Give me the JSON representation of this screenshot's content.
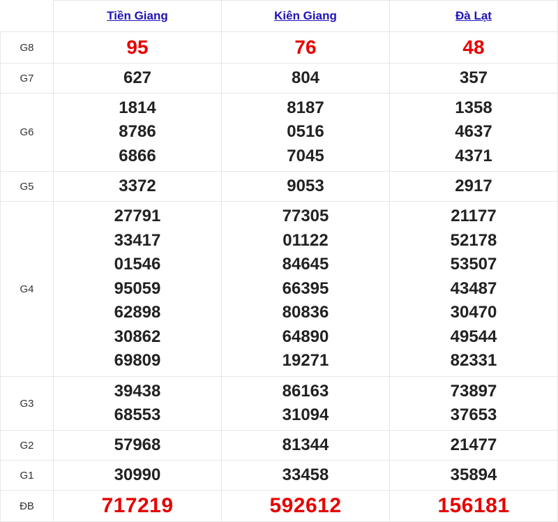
{
  "provinces": [
    "Tiền Giang",
    "Kiên Giang",
    "Đà Lạt"
  ],
  "colors": {
    "header_link": "#1f13b8",
    "highlight": "#e60000",
    "text": "#222222",
    "border": "#e6e6e6"
  },
  "rows": [
    {
      "label": "G8",
      "values": [
        [
          "95"
        ],
        [
          "76"
        ],
        [
          "48"
        ]
      ]
    },
    {
      "label": "G7",
      "values": [
        [
          "627"
        ],
        [
          "804"
        ],
        [
          "357"
        ]
      ]
    },
    {
      "label": "G6",
      "values": [
        [
          "1814",
          "8786",
          "6866"
        ],
        [
          "8187",
          "0516",
          "7045"
        ],
        [
          "1358",
          "4637",
          "4371"
        ]
      ]
    },
    {
      "label": "G5",
      "values": [
        [
          "3372"
        ],
        [
          "9053"
        ],
        [
          "2917"
        ]
      ]
    },
    {
      "label": "G4",
      "values": [
        [
          "27791",
          "33417",
          "01546",
          "95059",
          "62898",
          "30862",
          "69809"
        ],
        [
          "77305",
          "01122",
          "84645",
          "66395",
          "80836",
          "64890",
          "19271"
        ],
        [
          "21177",
          "52178",
          "53507",
          "43487",
          "30470",
          "49544",
          "82331"
        ]
      ]
    },
    {
      "label": "G3",
      "values": [
        [
          "39438",
          "68553"
        ],
        [
          "86163",
          "31094"
        ],
        [
          "73897",
          "37653"
        ]
      ]
    },
    {
      "label": "G2",
      "values": [
        [
          "57968"
        ],
        [
          "81344"
        ],
        [
          "21477"
        ]
      ]
    },
    {
      "label": "G1",
      "values": [
        [
          "30990"
        ],
        [
          "33458"
        ],
        [
          "35894"
        ]
      ]
    },
    {
      "label": "ĐB",
      "values": [
        [
          "717219"
        ],
        [
          "592612"
        ],
        [
          "156181"
        ]
      ]
    }
  ]
}
